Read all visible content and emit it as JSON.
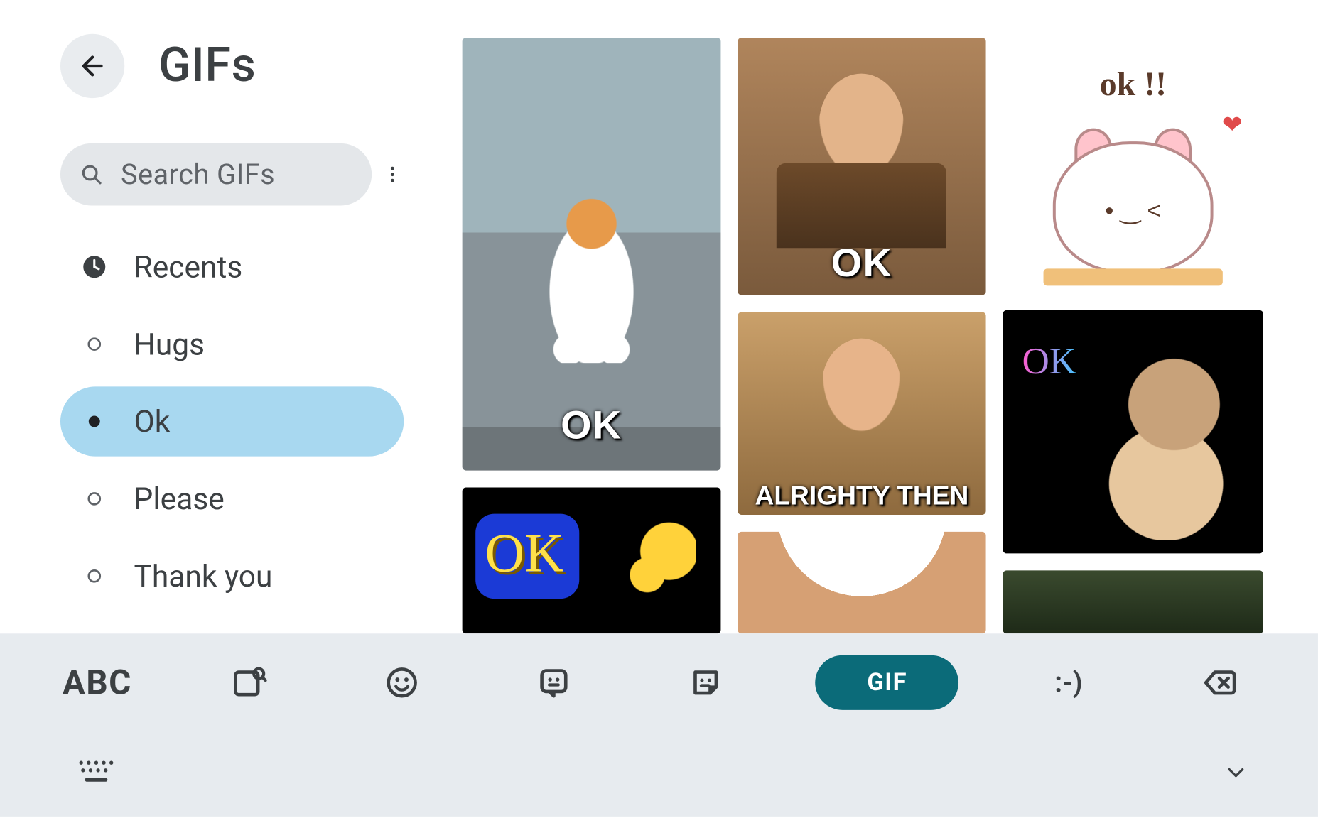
{
  "header": {
    "title": "GIFs"
  },
  "search": {
    "placeholder": "Search GIFs"
  },
  "categories": [
    {
      "key": "recents",
      "label": "Recents",
      "icon": "clock",
      "selected": false
    },
    {
      "key": "hugs",
      "label": "Hugs",
      "icon": "ring",
      "selected": false
    },
    {
      "key": "ok",
      "label": "Ok",
      "icon": "dot",
      "selected": true
    },
    {
      "key": "please",
      "label": "Please",
      "icon": "ring",
      "selected": false
    },
    {
      "key": "thankyou",
      "label": "Thank you",
      "icon": "ring",
      "selected": false
    }
  ],
  "gifs": {
    "col1": [
      {
        "key": "cat-ok",
        "caption": "OK"
      },
      {
        "key": "ok-thumb",
        "caption": "OK"
      }
    ],
    "col2": [
      {
        "key": "bean",
        "caption": "OK"
      },
      {
        "key": "ace",
        "caption": "ALRIGHTY THEN"
      },
      {
        "key": "face",
        "caption": ""
      }
    ],
    "col3": [
      {
        "key": "okii",
        "caption": "ok !!"
      },
      {
        "key": "okcat",
        "caption": "OK"
      },
      {
        "key": "dark",
        "caption": ""
      }
    ]
  },
  "bottom_bar": {
    "abc": "ABC",
    "gif": "GIF",
    "emoticon": ":-)"
  }
}
